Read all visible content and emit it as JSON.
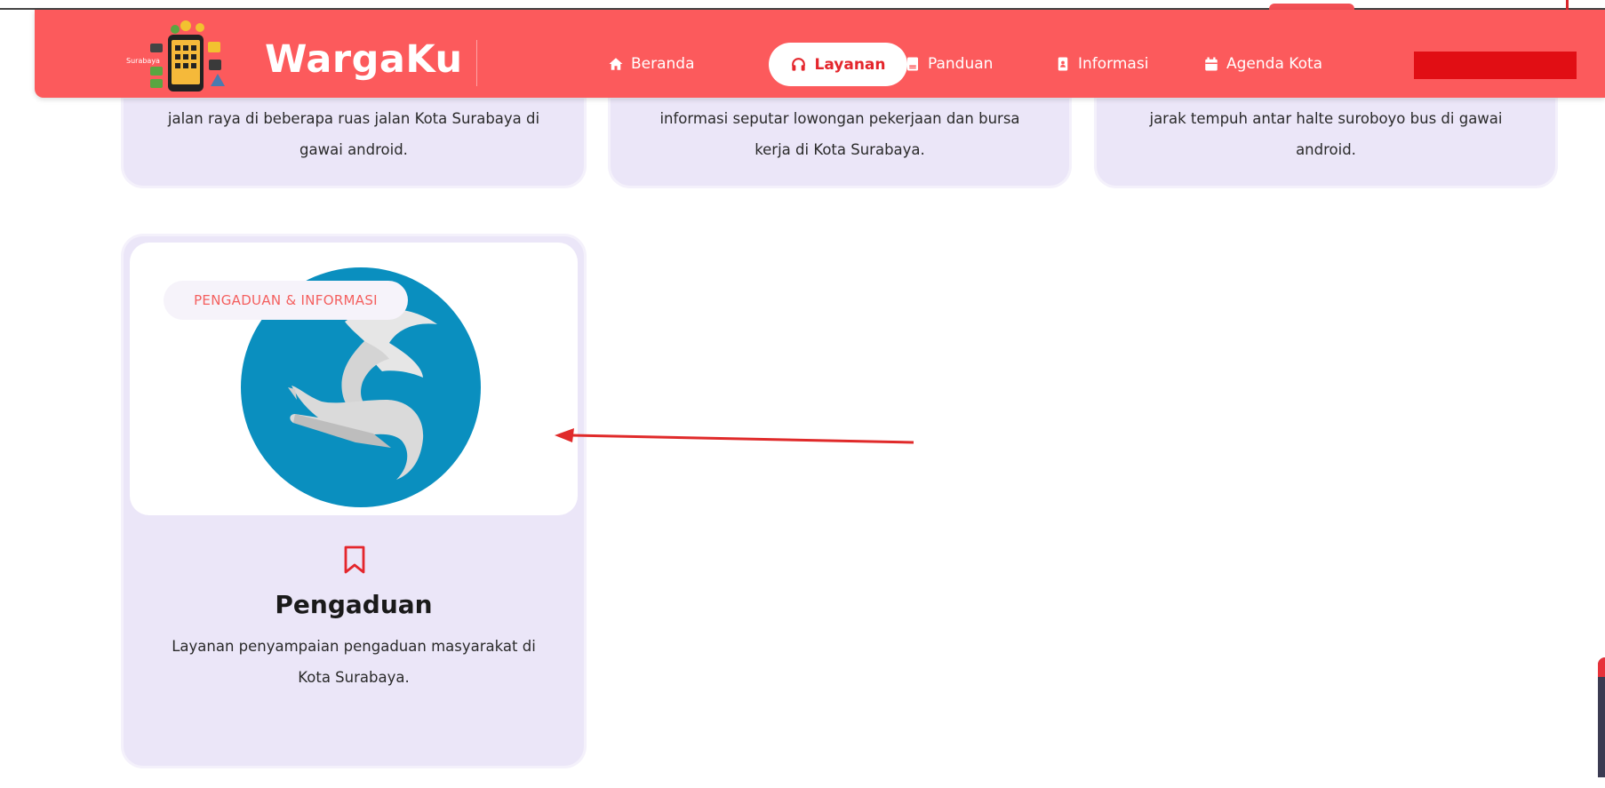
{
  "brand": {
    "name": "WargaKu",
    "logo_caption": "Surabaya"
  },
  "nav": {
    "items": [
      {
        "label": "Beranda",
        "icon": "home-icon"
      },
      {
        "label": "Layanan",
        "icon": "headphones-icon",
        "active": true
      },
      {
        "label": "Panduan",
        "icon": "book-icon"
      },
      {
        "label": "Informasi",
        "icon": "contact-card-icon"
      },
      {
        "label": "Agenda Kota",
        "icon": "calendar-icon"
      }
    ]
  },
  "cards_top": [
    {
      "description": "jalan raya di beberapa ruas jalan Kota Surabaya di gawai android."
    },
    {
      "description": "informasi seputar lowongan pekerjaan dan bursa kerja di Kota Surabaya."
    },
    {
      "description": "jarak tempuh antar halte suroboyo bus di gawai android."
    }
  ],
  "featured_card": {
    "badge": "PENGADUAN & INFORMASI",
    "icon": "bookmark-icon",
    "title": "Pengaduan",
    "description": "Layanan penyampaian pengaduan masyarakat di Kota Surabaya."
  },
  "colors": {
    "navbar": "#fc5a5c",
    "active_text": "#e4262c",
    "card_bg": "#ebe6f8",
    "logo_circle": "#0a8fbf",
    "arrow": "#e02a2a"
  }
}
